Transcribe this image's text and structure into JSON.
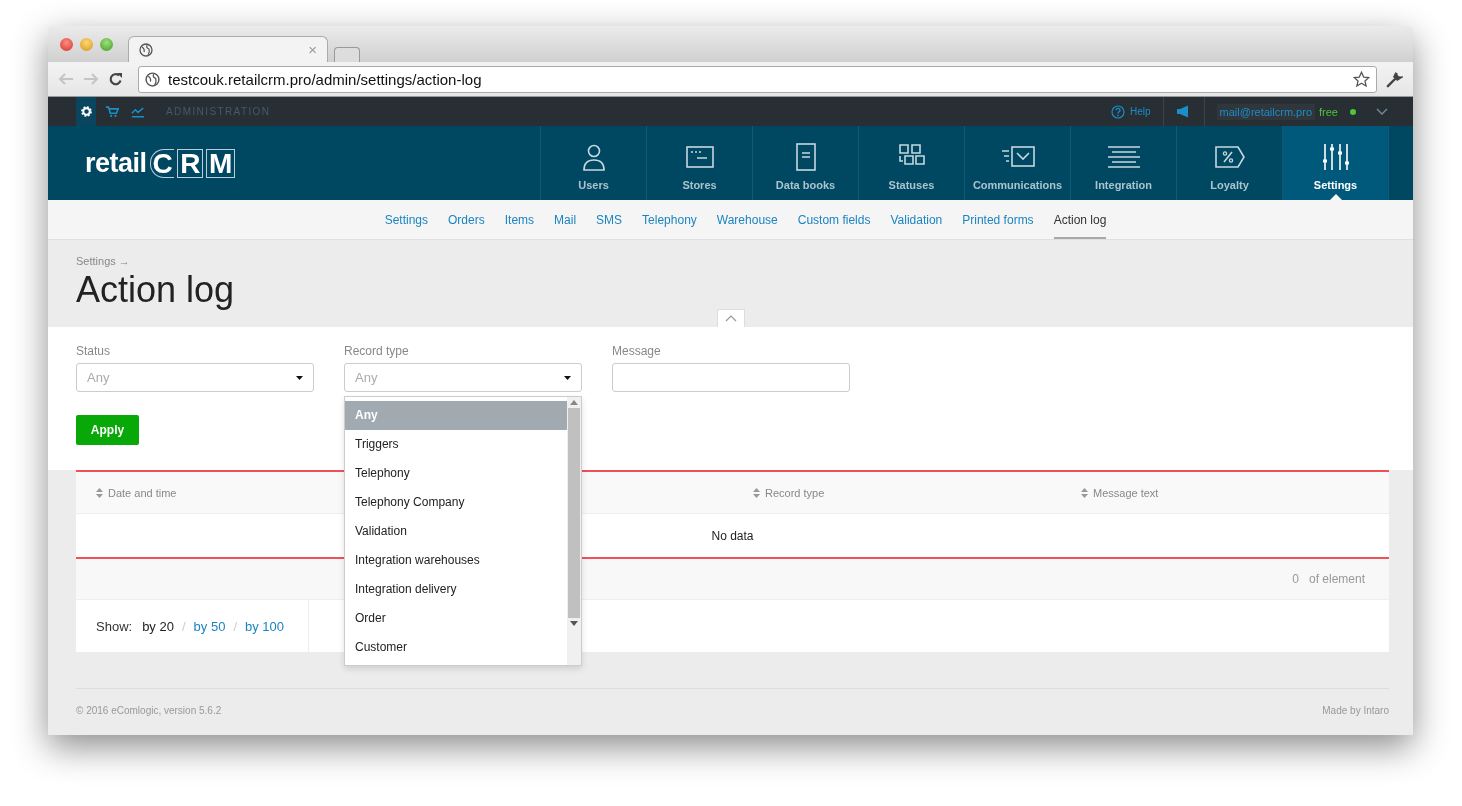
{
  "browser": {
    "tab_close": "×",
    "url": "testcouk.retailcrm.pro/admin/settings/action-log"
  },
  "admin_bar": {
    "apps": [
      {
        "kind": "settings",
        "selected": true
      },
      {
        "kind": "cart",
        "selected": false
      },
      {
        "kind": "chart",
        "selected": false
      }
    ],
    "label": "ADMINISTRATION",
    "help": "Help",
    "email": "mail@retailcrm.pro",
    "plan": "free"
  },
  "logo": {
    "text": "retail",
    "letters": [
      "C",
      "R",
      "M"
    ]
  },
  "main_nav": [
    {
      "kind": "users",
      "label": "Users",
      "selected": false
    },
    {
      "kind": "stores",
      "label": "Stores",
      "selected": false
    },
    {
      "kind": "books",
      "label": "Data books",
      "selected": false
    },
    {
      "kind": "statuses",
      "label": "Statuses",
      "selected": false
    },
    {
      "kind": "communications",
      "label": "Communications",
      "selected": false
    },
    {
      "kind": "integration",
      "label": "Integration",
      "selected": false
    },
    {
      "kind": "loyalty",
      "label": "Loyalty",
      "selected": false
    },
    {
      "kind": "settings",
      "label": "Settings",
      "selected": true
    }
  ],
  "sub_nav": [
    {
      "label": "Settings",
      "selected": false
    },
    {
      "label": "Orders",
      "selected": false
    },
    {
      "label": "Items",
      "selected": false
    },
    {
      "label": "Mail",
      "selected": false
    },
    {
      "label": "SMS",
      "selected": false
    },
    {
      "label": "Telephony",
      "selected": false
    },
    {
      "label": "Warehouse",
      "selected": false
    },
    {
      "label": "Custom fields",
      "selected": false
    },
    {
      "label": "Validation",
      "selected": false
    },
    {
      "label": "Printed forms",
      "selected": false
    },
    {
      "label": "Action log",
      "selected": true
    }
  ],
  "breadcrumb": "Settings →",
  "title": "Action log",
  "filters": [
    {
      "kind": "select",
      "label": "Status",
      "value": "Any"
    },
    {
      "kind": "select",
      "label": "Record type",
      "value": "Any",
      "open_options": [
        {
          "label": "Any",
          "selected": true
        },
        {
          "label": "Triggers",
          "selected": false
        },
        {
          "label": "Telephony",
          "selected": false
        },
        {
          "label": "Telephony Company",
          "selected": false
        },
        {
          "label": "Validation",
          "selected": false
        },
        {
          "label": "Integration warehouses",
          "selected": false
        },
        {
          "label": "Integration delivery",
          "selected": false
        },
        {
          "label": "Order",
          "selected": false
        },
        {
          "label": "Customer",
          "selected": false
        }
      ]
    },
    {
      "kind": "text",
      "label": "Message"
    }
  ],
  "apply_button": "Apply",
  "table": {
    "columns": [
      "Date and time",
      "Record type",
      "Message text"
    ],
    "empty_text": "No data",
    "count": "0",
    "count_label": "of element"
  },
  "pagination": {
    "label": "Show:",
    "separator": "/",
    "sizes": [
      {
        "label": "by 20",
        "selected": true
      },
      {
        "label": "by 50",
        "selected": false
      },
      {
        "label": "by 100",
        "selected": false
      }
    ]
  },
  "footer": {
    "copyright": "© 2016 eComlogic, version 5.6.2",
    "credit": "Made by Intaro"
  }
}
